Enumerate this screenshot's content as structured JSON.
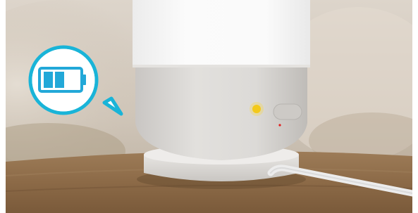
{
  "scene": {
    "subject": "lamp-with-charging-base",
    "battery_level_fraction": 0.5,
    "indicator_light_color": "#f2c200",
    "status_dot_color": "#e02020"
  },
  "colors": {
    "background_top": "#d9d1c7",
    "background_mid": "#c8bfb3",
    "table_wood": "#8a6a4a",
    "lamp_shade": "#f7f7f7",
    "lamp_base": "#d8d6d3",
    "badge_ring": "#19b4d8",
    "badge_fill": "#ffffff",
    "battery_cells": "#22a8d8"
  }
}
